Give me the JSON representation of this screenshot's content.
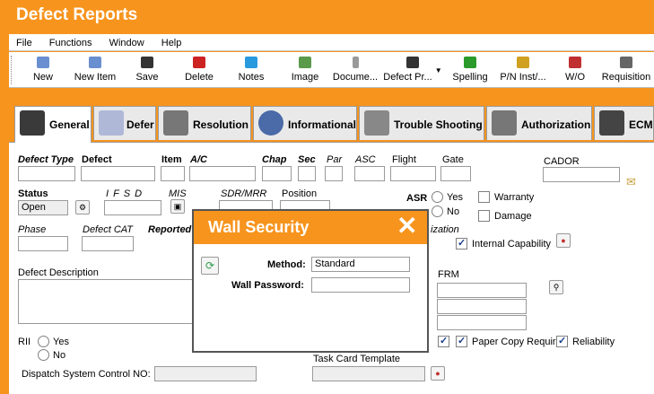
{
  "app": {
    "title": "Defect Reports"
  },
  "menu": [
    "File",
    "Functions",
    "Window",
    "Help"
  ],
  "toolbar": [
    {
      "label": "New",
      "icon": "new-icon",
      "color": "#6a8fd0"
    },
    {
      "label": "New Item",
      "icon": "new-item-icon",
      "color": "#6a8fd0"
    },
    {
      "label": "Save",
      "icon": "save-icon",
      "color": "#333333"
    },
    {
      "label": "Delete",
      "icon": "delete-icon",
      "color": "#cc2222"
    },
    {
      "label": "Notes",
      "icon": "notes-icon",
      "color": "#2a9adf"
    },
    {
      "label": "Image",
      "icon": "image-icon",
      "color": "#5a9a4a"
    },
    {
      "label": "Docume...",
      "icon": "document-icon",
      "color": "#999999"
    },
    {
      "label": "Defect Pr...",
      "icon": "printer-icon",
      "color": "#333333"
    },
    {
      "label": "Spelling",
      "icon": "spelling-icon",
      "color": "#2a9a2a"
    },
    {
      "label": "P/N Inst/...",
      "icon": "part-install-icon",
      "color": "#d0a020"
    },
    {
      "label": "W/O",
      "icon": "work-order-icon",
      "color": "#c03030"
    },
    {
      "label": "Requisition",
      "icon": "requisition-icon",
      "color": "#666666"
    }
  ],
  "tabs": [
    {
      "label": "General",
      "icon": "general-icon",
      "active": true
    },
    {
      "label": "Defer",
      "icon": "defer-icon",
      "active": false
    },
    {
      "label": "Resolution",
      "icon": "resolution-icon",
      "active": false
    },
    {
      "label": "Informational",
      "icon": "info-icon",
      "active": false
    },
    {
      "label": "Trouble Shooting",
      "icon": "trouble-shooting-icon",
      "active": false
    },
    {
      "label": "Authorization",
      "icon": "authorization-icon",
      "active": false
    },
    {
      "label": "ECM",
      "icon": "ecm-icon",
      "active": false
    }
  ],
  "form": {
    "defect_type": "Defect Type",
    "defect": "Defect",
    "item": "Item",
    "ac": "A/C",
    "chap": "Chap",
    "sec": "Sec",
    "par": "Par",
    "asc": "ASC",
    "flight": "Flight",
    "gate": "Gate",
    "cador": "CADOR",
    "status_label": "Status",
    "status_value": "Open",
    "ifsd": "I F S D",
    "mis": "MIS",
    "sdr_mrr": "SDR/MRR",
    "position": "Position",
    "asr": "ASR",
    "yes": "Yes",
    "no": "No",
    "warranty": "Warranty",
    "damage": "Damage",
    "phase": "Phase",
    "defect_cat": "Defect CAT",
    "reported": "Reported",
    "authorization_partial": "ization",
    "internal_capability": "Internal Capability",
    "defect_description": "Defect Description",
    "frm": "FRM",
    "rii": "RII",
    "rii_yes": "Yes",
    "rii_no": "No",
    "paper_copy_required": "Paper Copy Required",
    "reliability": "Reliability",
    "task_card_template": "Task Card Template",
    "dispatch_system_control_no": "Dispatch System Control NO:"
  },
  "dialog": {
    "title": "Wall Security",
    "method_label": "Method:",
    "method_value": "Standard",
    "password_label": "Wall Password:",
    "password_value": ""
  },
  "colors": {
    "accent": "#f7941d",
    "tab_bg": "#e9e9e9",
    "check": "#1a3c8a"
  }
}
